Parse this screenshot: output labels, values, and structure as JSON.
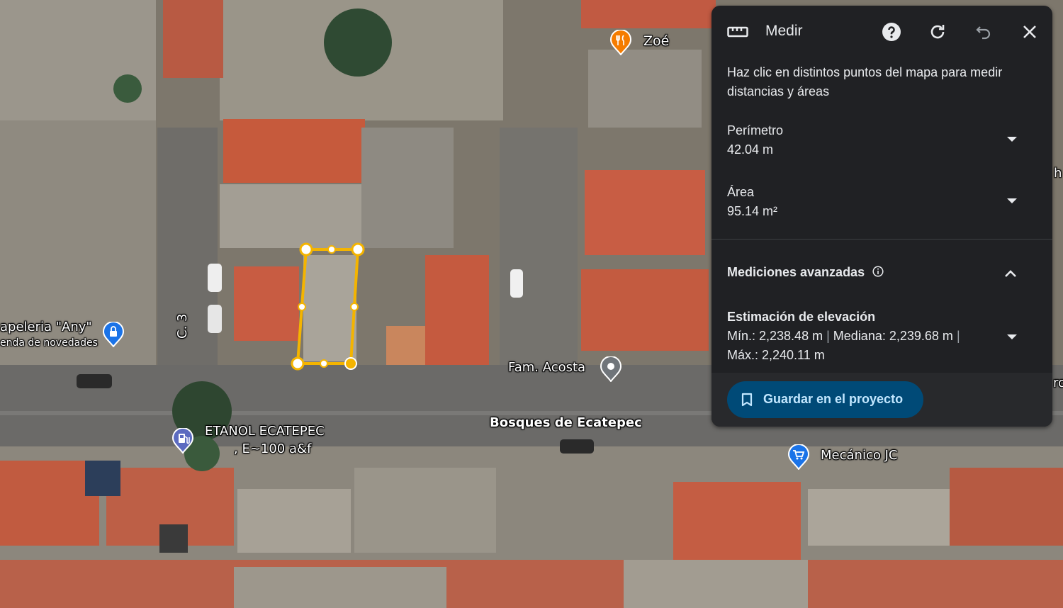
{
  "map": {
    "labels": {
      "zoe": "Zoé",
      "papeleria_line1": "apeleria \"Any\"",
      "papeleria_line2": "enda de novedades",
      "calle": "C. 3",
      "fam_acosta": "Fam. Acosta",
      "etanol_line1": "ETANOL ECATEPEC",
      "etanol_line2": ", E~100 a&f",
      "bosques": "Bosques de Ecatepec",
      "mecanico": "Mecánico JC",
      "edge_right_1": "h",
      "edge_right_2": "ro"
    },
    "colors": {
      "measure_line": "#f4b400",
      "restaurant_pin": "#f57c00",
      "shop_pin": "#1a73e8",
      "gas_pin": "#5c6bc0",
      "landmark_pin": "#70757a"
    },
    "icons": [
      "restaurant-pin-icon",
      "lock-pin-icon",
      "gas-station-pin-icon",
      "landmark-pin-icon",
      "shopping-cart-pin-icon"
    ]
  },
  "panel": {
    "title": "Medir",
    "icons": [
      "ruler-icon",
      "help-icon",
      "refresh-icon",
      "undo-icon",
      "close-icon"
    ],
    "hint": "Haz clic en distintos puntos del mapa para medir distancias y áreas",
    "perimeter_label": "Perímetro",
    "perimeter_value": "42.04 m",
    "area_label": "Área",
    "area_value": "95.14 m²",
    "advanced_label": "Mediciones avanzadas",
    "elevation_title": "Estimación de elevación",
    "elev_min": "Mín.: 2,238.48 m",
    "elev_median": "Mediana: 2,239.68 m",
    "elev_max": "Máx.: 2,240.11 m",
    "sep": "|",
    "save_label": "Guardar en el proyecto",
    "colors": {
      "background": "#202124",
      "save_bg": "#004a77",
      "save_text": "#c2e7ff"
    }
  }
}
